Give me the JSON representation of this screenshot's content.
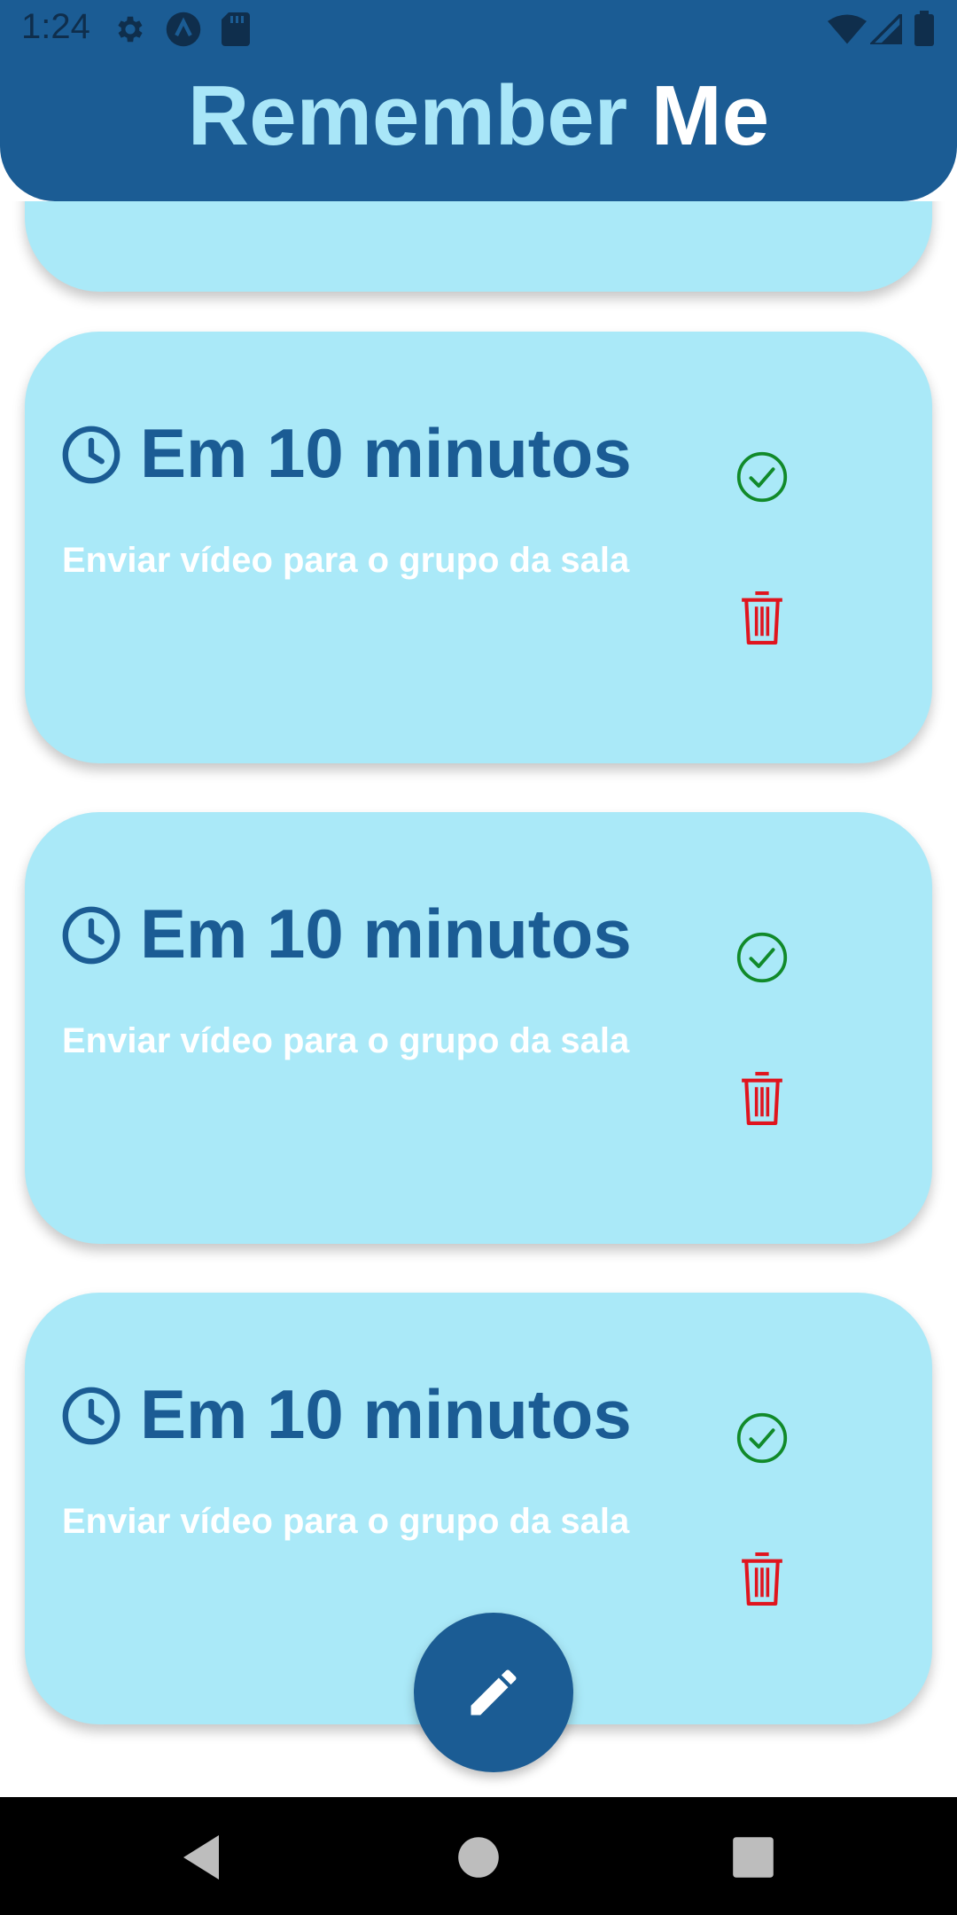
{
  "status_bar": {
    "time": "1:24",
    "left_icons": [
      "settings-icon",
      "app-logo-icon",
      "sd-card-icon"
    ],
    "right_icons": [
      "wifi-icon",
      "signal-icon",
      "battery-icon"
    ]
  },
  "header": {
    "title_part1": "Remember",
    "title_part2": "Me",
    "background": "#1b5c94",
    "accent": "#a9e6f8"
  },
  "reminders": [
    {
      "title": "Em 10 minutos",
      "text": "Enviar vídeo para o grupo da sala",
      "icon": "clock-icon",
      "actions": [
        "check-circle-icon",
        "trash-icon"
      ]
    },
    {
      "title": "Em 10 minutos",
      "text": "Enviar vídeo para o grupo da sala",
      "icon": "clock-icon",
      "actions": [
        "check-circle-icon",
        "trash-icon"
      ]
    },
    {
      "title": "Em 10 minutos",
      "text": "Enviar vídeo para o grupo da sala",
      "icon": "clock-icon",
      "actions": [
        "check-circle-icon",
        "trash-icon"
      ]
    }
  ],
  "fab": {
    "icon": "pencil-icon"
  },
  "colors": {
    "card_background": "#aae9f8",
    "card_title": "#1b5c94",
    "check": "#118a2a",
    "trash": "#e0141e"
  },
  "nav_bar": {
    "buttons": [
      "back-icon",
      "home-icon",
      "recents-icon"
    ]
  }
}
